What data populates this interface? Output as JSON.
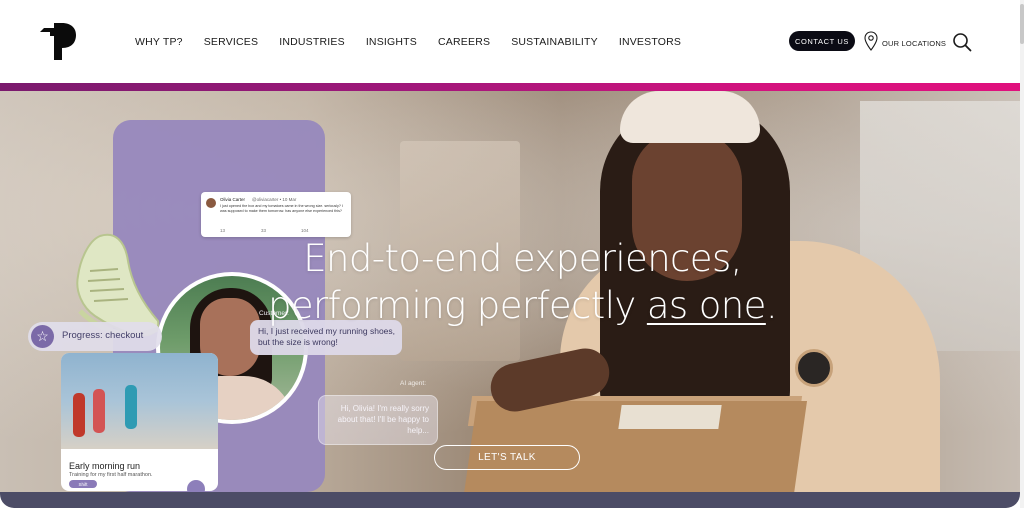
{
  "brand": {
    "logo": "TP"
  },
  "nav": {
    "items": [
      "WHY TP?",
      "SERVICES",
      "INDUSTRIES",
      "INSIGHTS",
      "CAREERS",
      "SUSTAINABILITY",
      "INVESTORS"
    ]
  },
  "header": {
    "contact_label": "CONTACT US",
    "locations_label": "OUR LOCATIONS",
    "accent_gradient": [
      "#7a1a6d",
      "#e0107d"
    ]
  },
  "hero": {
    "headline_line1": "End-to-end experiences,",
    "headline_line2_a": "performing perfectly ",
    "headline_line2_b": "as one",
    "headline_line2_c": ".",
    "cta_label": "LET'S TALK",
    "tweet": {
      "name": "Olivia Carter",
      "handle": "@oliviacarter • 10 Mar",
      "text": "I just opened the box and my tomatoes came in the wrong size. seriously? I was supposed to make them tomorrow. has anyone else experienced this?",
      "reply_count": "13",
      "retweet_count": "33",
      "like_count": "104"
    },
    "progress_label": "Progress: checkout",
    "customer_label": "Customer:",
    "customer_message": "Hi, I just received my running shoes, but the size is wrong!",
    "ai_label": "AI agent:",
    "ai_message": "Hi, Olivia! I'm really sorry about that! I'll be happy to help...",
    "run_card": {
      "title": "Early morning run",
      "subtitle": "Training for my first half marathon.",
      "tag": "Shift"
    }
  }
}
